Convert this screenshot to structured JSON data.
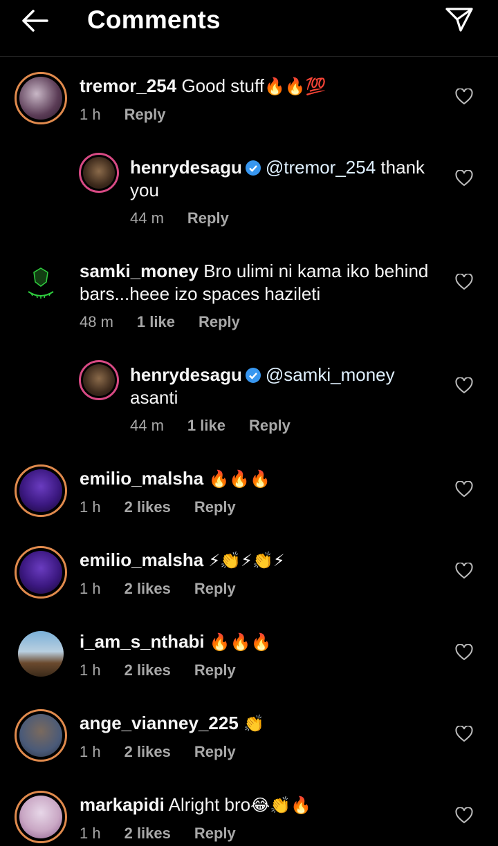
{
  "header": {
    "title": "Comments",
    "back_icon": "arrow-left-icon",
    "send_icon": "paper-plane-icon"
  },
  "colors": {
    "background": "#000000",
    "secondary_text": "#a8a8a8",
    "story_ring": "#e08a4d",
    "verified": "#3897f0"
  },
  "comments": [
    {
      "username": "tremor_254",
      "text": "Good stuff",
      "emojis": "🔥🔥💯",
      "time": "1 h",
      "likes": "",
      "reply": "Reply",
      "is_reply": false
    },
    {
      "username": "henrydesagu",
      "verified": true,
      "mention": "@tremor_254",
      "text": "thank you",
      "time": "44 m",
      "likes": "",
      "reply": "Reply",
      "is_reply": true
    },
    {
      "username": "samki_money",
      "text": "Bro ulimi ni kama iko behind bars...heee izo spaces hazileti",
      "time": "48 m",
      "likes": "1 like",
      "reply": "Reply",
      "is_reply": false
    },
    {
      "username": "henrydesagu",
      "verified": true,
      "mention": "@samki_money",
      "text": "asanti",
      "time": "44 m",
      "likes": "1 like",
      "reply": "Reply",
      "is_reply": true
    },
    {
      "username": "emilio_malsha",
      "text": "",
      "emojis": "🔥🔥🔥",
      "time": "1 h",
      "likes": "2 likes",
      "reply": "Reply",
      "is_reply": false
    },
    {
      "username": "emilio_malsha",
      "text": "",
      "emojis": "⚡👏⚡👏⚡",
      "time": "1 h",
      "likes": "2 likes",
      "reply": "Reply",
      "is_reply": false
    },
    {
      "username": "i_am_s_nthabi",
      "text": "",
      "emojis": "🔥🔥🔥",
      "time": "1 h",
      "likes": "2 likes",
      "reply": "Reply",
      "is_reply": false
    },
    {
      "username": "ange_vianney_225",
      "text": "",
      "emojis": "👏",
      "time": "1 h",
      "likes": "2 likes",
      "reply": "Reply",
      "is_reply": false
    },
    {
      "username": "markapidi",
      "text": "Alright bro",
      "emojis": "😂👏🔥",
      "time": "1 h",
      "likes": "2 likes",
      "reply": "Reply",
      "is_reply": false
    }
  ]
}
